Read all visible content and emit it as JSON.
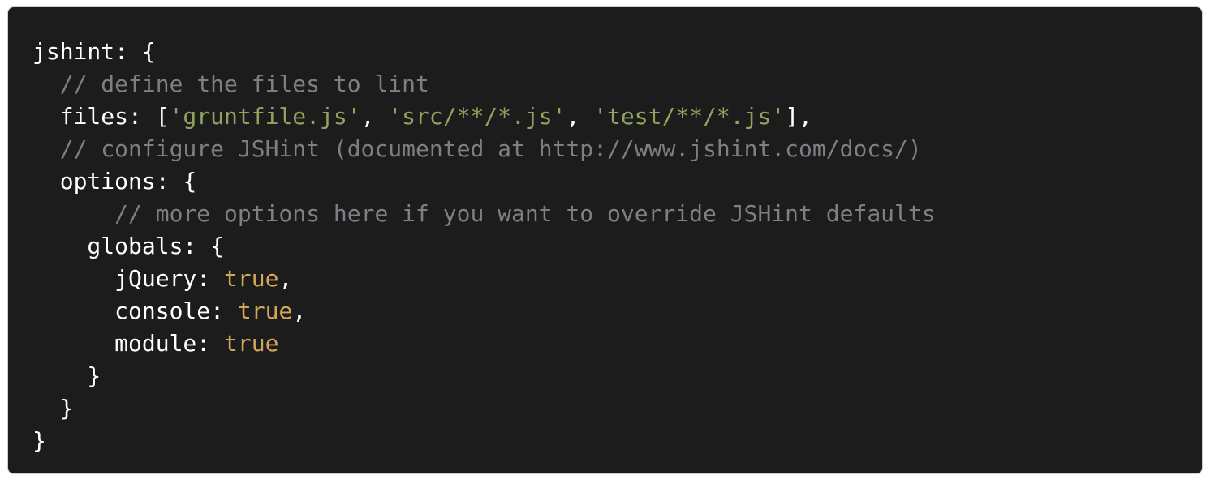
{
  "code": {
    "lines": [
      [
        {
          "t": "jshint: {",
          "k": "plain"
        }
      ],
      [
        {
          "t": "  ",
          "k": "plain"
        },
        {
          "t": "// define the files to lint",
          "k": "comment"
        }
      ],
      [
        {
          "t": "  files: [",
          "k": "plain"
        },
        {
          "t": "'gruntfile.js'",
          "k": "string"
        },
        {
          "t": ", ",
          "k": "plain"
        },
        {
          "t": "'src/**/*.js'",
          "k": "string"
        },
        {
          "t": ", ",
          "k": "plain"
        },
        {
          "t": "'test/**/*.js'",
          "k": "string"
        },
        {
          "t": "],",
          "k": "plain"
        }
      ],
      [
        {
          "t": "  ",
          "k": "plain"
        },
        {
          "t": "// configure JSHint (documented at http://www.jshint.com/docs/)",
          "k": "comment"
        }
      ],
      [
        {
          "t": "  options: {",
          "k": "plain"
        }
      ],
      [
        {
          "t": "      ",
          "k": "plain"
        },
        {
          "t": "// more options here if you want to override JSHint defaults",
          "k": "comment"
        }
      ],
      [
        {
          "t": "    globals: {",
          "k": "plain"
        }
      ],
      [
        {
          "t": "      jQuery: ",
          "k": "plain"
        },
        {
          "t": "true",
          "k": "bool"
        },
        {
          "t": ",",
          "k": "plain"
        }
      ],
      [
        {
          "t": "      console: ",
          "k": "plain"
        },
        {
          "t": "true",
          "k": "bool"
        },
        {
          "t": ",",
          "k": "plain"
        }
      ],
      [
        {
          "t": "      module: ",
          "k": "plain"
        },
        {
          "t": "true",
          "k": "bool"
        }
      ],
      [
        {
          "t": "    }",
          "k": "plain"
        }
      ],
      [
        {
          "t": "  }",
          "k": "plain"
        }
      ],
      [
        {
          "t": "}",
          "k": "plain"
        }
      ]
    ]
  },
  "colors": {
    "background": "#1c1c1c",
    "text": "#ffffff",
    "comment": "#7e7e84",
    "string": "#8fa35d",
    "boolean": "#d4a657"
  }
}
